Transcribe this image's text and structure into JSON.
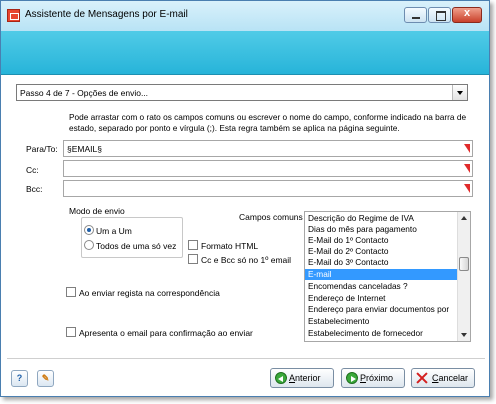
{
  "window": {
    "title": "Assistente de Mensagens por E-mail",
    "close_glyph": "x"
  },
  "step": {
    "selected": "Passo 4 de 7 - Opções de envio..."
  },
  "instructions": "Pode arrastar com o rato os campos comuns ou escrever  o nome do campo, conforme indicado na barra de estado, separado por ponto e vírgula (;). Esta regra também se aplica na página seguinte.",
  "fields": {
    "to_label": "Para/To:",
    "to_value": "§EMAIL§",
    "cc_label": "Cc:",
    "cc_value": "",
    "bcc_label": "Bcc:",
    "bcc_value": ""
  },
  "send_mode": {
    "label": "Modo de envio",
    "one_to_one": "Um a Um",
    "all_at_once": "Todos de uma só vez",
    "selected": "Um a Um"
  },
  "options": {
    "html_format": "Formato HTML",
    "cc_bcc_first_only": "Cc e Bcc só no 1º email",
    "register_correspondence": "Ao enviar regista na correspondência",
    "show_before_send": "Apresenta o email para confirmação ao enviar"
  },
  "common_fields": {
    "label": "Campos comuns",
    "items": [
      "Descrição do Regime de IVA",
      "Dias do mês para pagamento",
      "E-Mail do 1º Contacto",
      "E-Mail do 2º Contacto",
      "E-Mail do 3º Contacto",
      "E-mail",
      "Encomendas canceladas ?",
      "Endereço de Internet",
      "Endereço para enviar documentos por",
      "Estabelecimento",
      "Estabelecimento de fornecedor"
    ],
    "selected": "E-mail"
  },
  "buttons": {
    "help_glyph": "?",
    "tool_glyph": "✎",
    "prev_prefix": "A",
    "prev_rest": "nterior",
    "next_prefix": "P",
    "next_rest": "róximo",
    "cancel_prefix": "C",
    "cancel_rest": "ancelar"
  },
  "colors": {
    "banner": "#27b4d9",
    "selection": "#3399ff",
    "required_marker": "#e02b2b"
  }
}
